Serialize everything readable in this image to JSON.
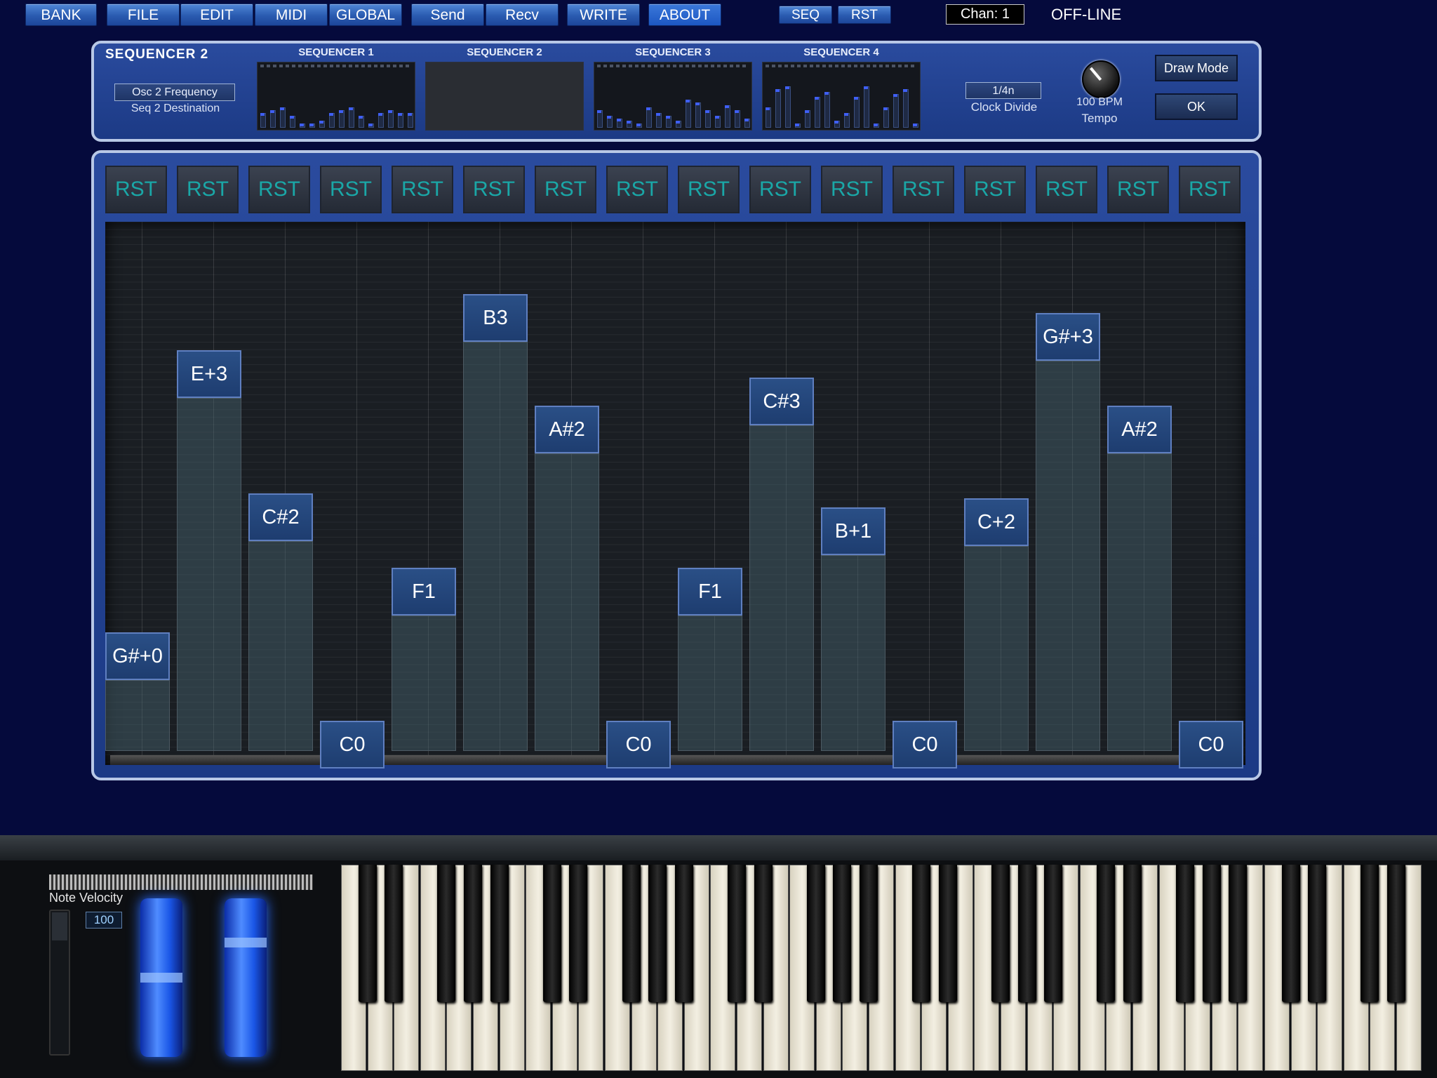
{
  "toolbar": {
    "menu": [
      "BANK",
      "FILE",
      "EDIT",
      "MIDI",
      "GLOBAL",
      "Send",
      "Recv",
      "WRITE",
      "ABOUT"
    ],
    "seq_label": "SEQ",
    "rst_label": "RST",
    "channel": "Chan: 1",
    "status": "OFF-LINE"
  },
  "sequencer_panel": {
    "title": "SEQUENCER  2",
    "destination_value": "Osc 2 Frequency",
    "destination_label": "Seq 2 Destination",
    "mini_sequencers": [
      "SEQUENCER 1",
      "SEQUENCER 2",
      "SEQUENCER 3",
      "SEQUENCER 4"
    ],
    "clock_divide_value": "1/4n",
    "clock_divide_label": "Clock Divide",
    "tempo_value": "100 BPM",
    "tempo_label": "Tempo",
    "draw_mode_label": "Draw Mode",
    "ok_label": "OK"
  },
  "steps": {
    "reset_label": "RST",
    "notes": [
      "G#+0",
      "E+3",
      "C#2",
      "C0",
      "F1",
      "B3",
      "A#2",
      "C0",
      "F1",
      "C#3",
      "B+1",
      "C0",
      "C+2",
      "G#+3",
      "A#2",
      "C0"
    ],
    "levels": [
      0.18,
      0.79,
      0.48,
      0.0,
      0.32,
      0.91,
      0.67,
      0.0,
      0.32,
      0.73,
      0.45,
      0.0,
      0.47,
      0.87,
      0.67,
      0.0
    ]
  },
  "keyboard": {
    "velocity_label": "Note Velocity",
    "velocity_value": "100"
  }
}
